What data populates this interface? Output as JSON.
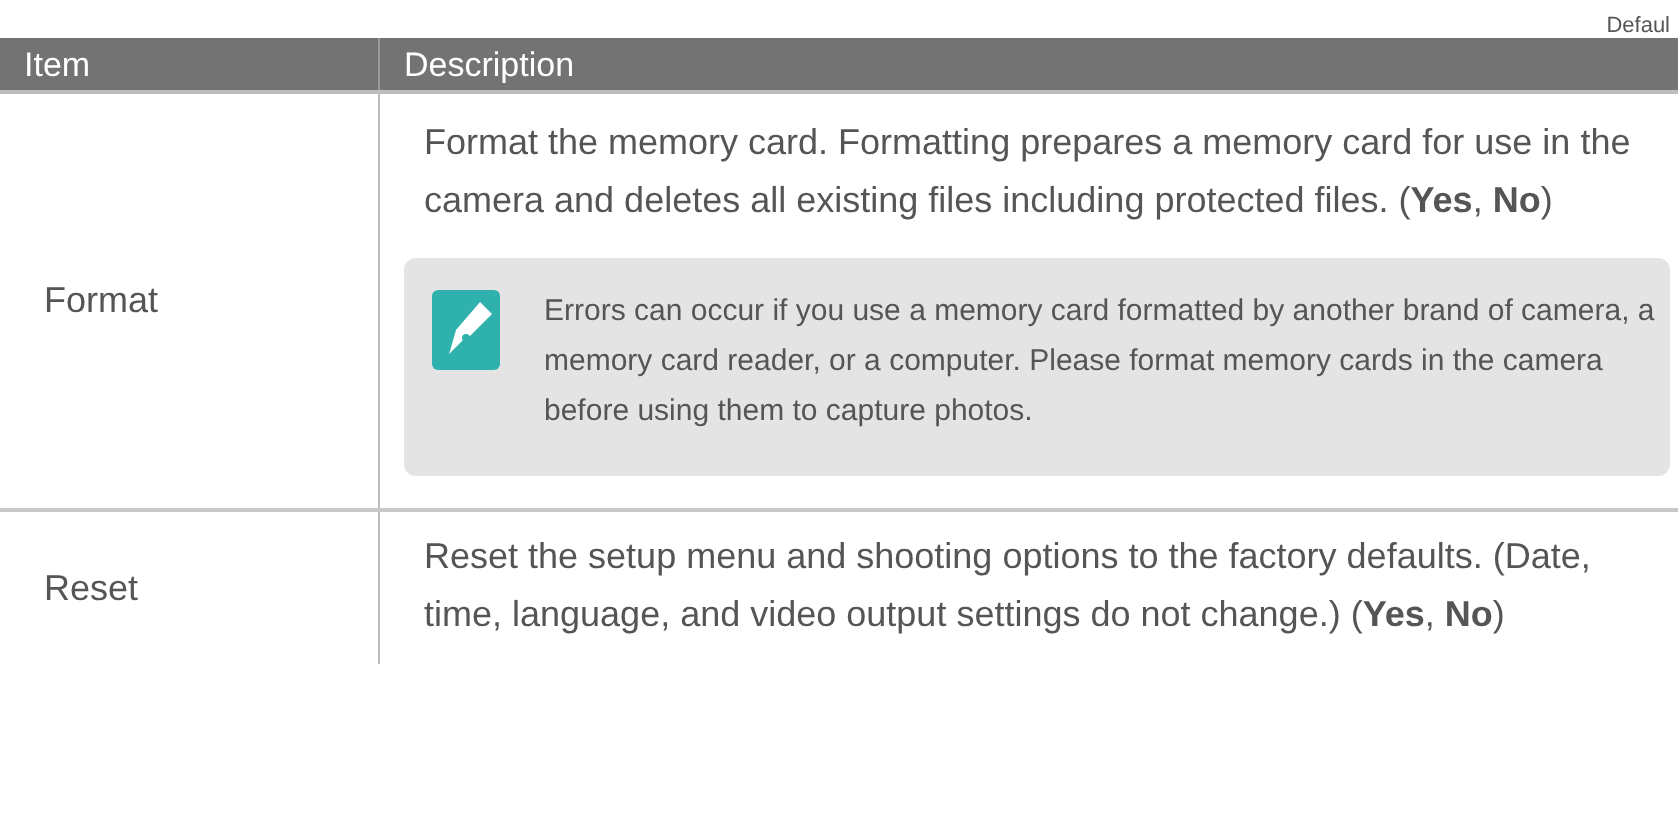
{
  "page_label": "Defaul",
  "table": {
    "columns": [
      "Item",
      "Description"
    ],
    "rows": [
      {
        "item": "Format",
        "description": "Format the memory card. Formatting prepares a memory card for use in the camera and deletes all existing files including protected files. (**Yes**, **No**)",
        "note": "Errors can occur if you use a memory card formatted by another brand of camera, a memory card reader, or a computer. Please format memory cards in the camera before using them to capture photos."
      },
      {
        "item": "Reset",
        "description": "Reset the setup menu and shooting options to the factory defaults. (Date, time, language, and video output settings do not change.) (**Yes**, **No**)"
      }
    ]
  }
}
